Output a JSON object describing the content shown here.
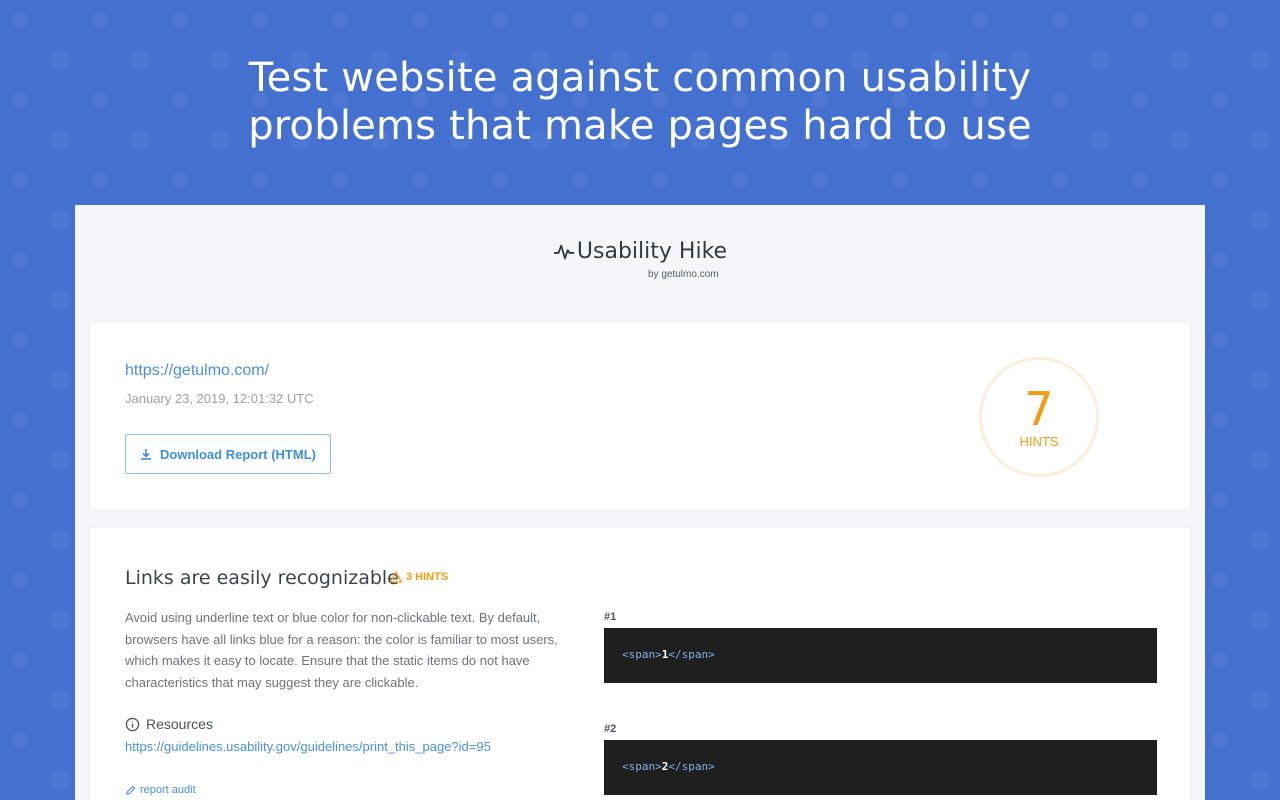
{
  "hero": {
    "line1": "Test website against common usability",
    "line2": "problems that make pages hard to use"
  },
  "brand": {
    "name": "Usability Hike",
    "by": "by getulmo.com",
    "icon": "pulse-icon"
  },
  "summary": {
    "url": "https://getulmo.com/",
    "date": "January 23, 2019, 12:01:32 UTC",
    "download_label": "Download Report (HTML)",
    "hints_count": "7",
    "hints_label": "HINTS",
    "accent": "#f39c12"
  },
  "audit": {
    "title": "Links are easily recognizable",
    "badge": "3 HINTS",
    "description": "Avoid using underline text or blue color for non-clickable text. By default, browsers have all links blue for a reason: the color is familiar to most users, which makes it easy to locate. Ensure that the static items do not have characteristics that may suggest they are clickable.",
    "resources_label": "Resources",
    "resource_link": "https://guidelines.usability.gov/guidelines/print_this_page?id=95",
    "report_label": "report audit",
    "snippets": [
      {
        "label": "#1",
        "open": "<span>",
        "value": "1",
        "close": "</span>"
      },
      {
        "label": "#2",
        "open": "<span>",
        "value": "2",
        "close": "</span>"
      }
    ]
  },
  "colors": {
    "background": "#4471d0",
    "link": "#4a90d9",
    "code_bg": "#1f1f1f"
  }
}
